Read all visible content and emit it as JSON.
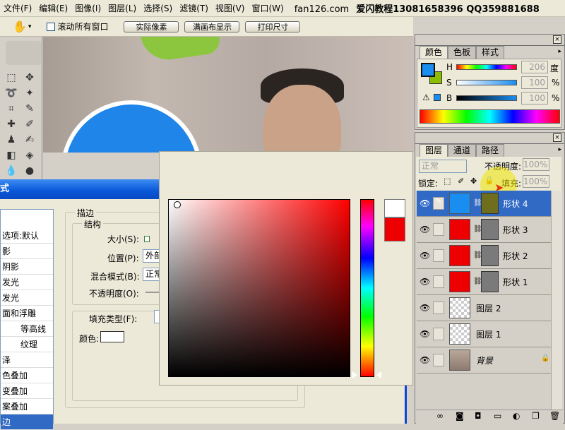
{
  "menubar": {
    "items": [
      "文件(F)",
      "编辑(E)",
      "图像(I)",
      "图层(L)",
      "选择(S)",
      "滤镜(T)",
      "视图(V)",
      "窗口(W)"
    ],
    "brand_url": "fan126.com",
    "brand_text": "爱闪教程13081658396 QQ359881688"
  },
  "options": {
    "scroll_all_label": "滚动所有窗口",
    "actual_pixels": "实际像素",
    "fit_screen": "满画布显示",
    "print_size": "打印尺寸"
  },
  "dialog": {
    "title": "式",
    "styles": [
      "选项:默认",
      "影",
      "阴影",
      "发光",
      "发光",
      "面和浮雕",
      "等高线",
      "纹理",
      "泽",
      "色叠加",
      "变叠加",
      "案叠加",
      "边"
    ],
    "stroke_group": "描边",
    "structure_group": "结构",
    "size_label": "大小(S):",
    "position_label": "位置(P):",
    "position_value": "外部",
    "blend_label": "混合模式(B):",
    "blend_value": "正常",
    "opacity_label": "不透明度(O):",
    "fill_type_label": "填充类型(F):",
    "color_label": "颜色:"
  },
  "color_panel": {
    "tabs": [
      "颜色",
      "色板",
      "样式"
    ],
    "h_label": "H",
    "s_label": "S",
    "b_label": "B",
    "h_value": "206",
    "s_value": "100",
    "b_value": "100",
    "h_unit": "度",
    "s_unit": "%",
    "b_unit": "%",
    "fg_color": "#1a8ef0",
    "bg_color": "#8cbd00"
  },
  "layers_panel": {
    "tabs": [
      "图层",
      "通道",
      "路径"
    ],
    "blend_mode": "正常",
    "opacity_label": "不透明度:",
    "opacity_value": "100%",
    "lock_label": "锁定:",
    "fill_label": "填充:",
    "fill_value": "100%",
    "layers": [
      {
        "name": "形状 4",
        "color": "#1a8ef0",
        "selected": true
      },
      {
        "name": "形状 3",
        "color": "#ee0000",
        "selected": false
      },
      {
        "name": "形状 2",
        "color": "#ee0000",
        "selected": false
      },
      {
        "name": "形状 1",
        "color": "#ee0000",
        "selected": false
      },
      {
        "name": "图层 2",
        "color": "transparent",
        "selected": false
      },
      {
        "name": "图层 1",
        "color": "transparent",
        "selected": false
      },
      {
        "name": "背景",
        "color": "photo",
        "selected": false
      }
    ]
  }
}
